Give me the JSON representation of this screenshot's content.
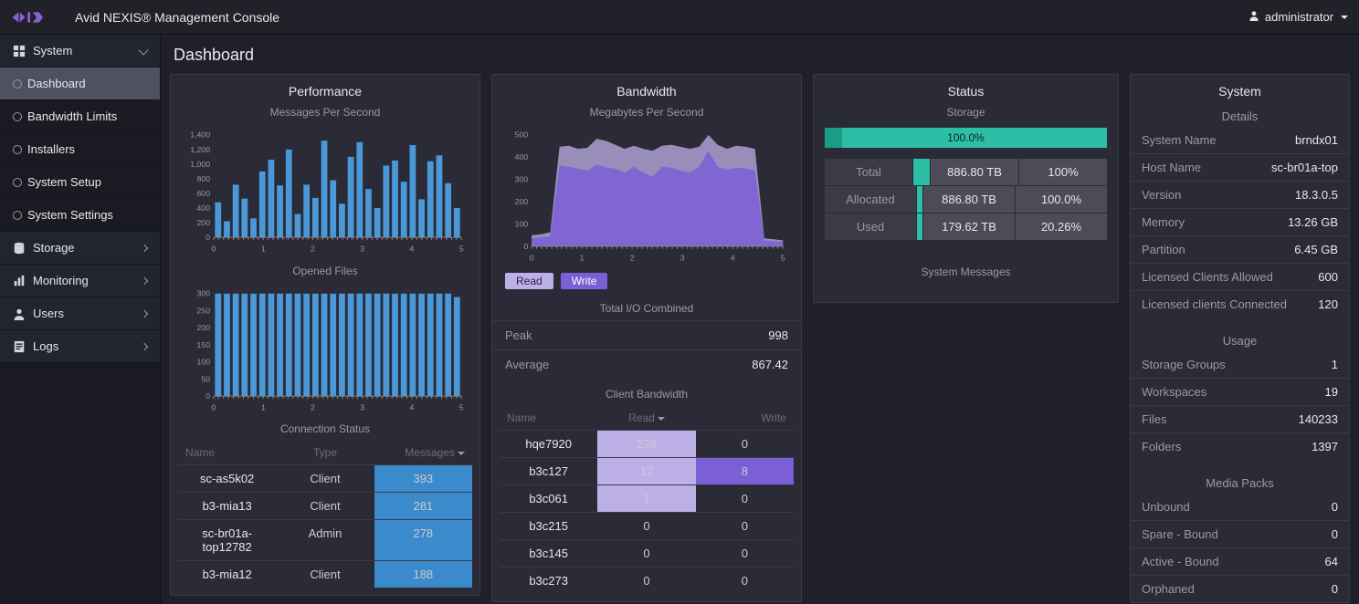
{
  "app_title": "Avid NEXIS® Management Console",
  "user": "administrator",
  "sidebar": {
    "system": {
      "label": "System",
      "expanded": true,
      "items": [
        {
          "label": "Dashboard",
          "active": true
        },
        {
          "label": "Bandwidth Limits"
        },
        {
          "label": "Installers"
        },
        {
          "label": "System Setup"
        },
        {
          "label": "System Settings"
        }
      ]
    },
    "sections": [
      {
        "label": "Storage"
      },
      {
        "label": "Monitoring"
      },
      {
        "label": "Users"
      },
      {
        "label": "Logs"
      }
    ]
  },
  "page_title": "Dashboard",
  "performance": {
    "title": "Performance",
    "messages": {
      "label": "Messages Per Second",
      "ymax": 1400,
      "xticks": [
        "0",
        "1",
        "2",
        "3",
        "4",
        "5"
      ],
      "yticks": [
        "0",
        "200",
        "400",
        "600",
        "800",
        "1,000",
        "1,200",
        "1,400"
      ]
    },
    "opened": {
      "label": "Opened Files",
      "ymax": 300,
      "xticks": [
        "0",
        "1",
        "2",
        "3",
        "4",
        "5"
      ],
      "yticks": [
        "0",
        "50",
        "100",
        "150",
        "200",
        "250",
        "300"
      ]
    },
    "conn": {
      "label": "Connection Status",
      "headers": {
        "name": "Name",
        "type": "Type",
        "messages": "Messages"
      },
      "rows": [
        {
          "name": "sc-as5k02",
          "type": "Client",
          "messages": 393
        },
        {
          "name": "b3-mia13",
          "type": "Client",
          "messages": 281
        },
        {
          "name": "sc-br01a-top12782",
          "type": "Admin",
          "messages": 278
        },
        {
          "name": "b3-mia12",
          "type": "Client",
          "messages": 188
        }
      ]
    }
  },
  "bandwidth": {
    "title": "Bandwidth",
    "mbps": {
      "label": "Megabytes Per Second",
      "xticks": [
        "0",
        "1",
        "2",
        "3",
        "4",
        "5"
      ],
      "yticks": [
        "0",
        "100",
        "200",
        "300",
        "400",
        "500"
      ]
    },
    "legend": {
      "read": "Read",
      "write": "Write"
    },
    "totalio": {
      "label": "Total I/O Combined",
      "peak_label": "Peak",
      "peak": 998,
      "avg_label": "Average",
      "avg": 867.42
    },
    "client": {
      "label": "Client Bandwidth",
      "headers": {
        "name": "Name",
        "read": "Read",
        "write": "Write"
      },
      "rows": [
        {
          "name": "hqe7920",
          "read": 278,
          "write": 0,
          "hl_read": true
        },
        {
          "name": "b3c127",
          "read": 17,
          "write": 8,
          "hl_read": true,
          "hl_write": true
        },
        {
          "name": "b3c061",
          "read": 1,
          "write": 0,
          "hl_read": true
        },
        {
          "name": "b3c215",
          "read": 0,
          "write": 0
        },
        {
          "name": "b3c145",
          "read": 0,
          "write": 0
        },
        {
          "name": "b3c273",
          "read": 0,
          "write": 0
        }
      ]
    }
  },
  "status": {
    "title": "Status",
    "storage_label": "Storage",
    "progress": {
      "pct": "100.0%",
      "inner": 6
    },
    "rows": [
      {
        "label": "Total",
        "bar": 100,
        "value": "886.80 TB",
        "pct": "100%"
      },
      {
        "label": "Allocated",
        "bar": 7,
        "value": "886.80 TB",
        "pct": "100.0%"
      },
      {
        "label": "Used",
        "bar": 7,
        "value": "179.62 TB",
        "pct": "20.26%"
      }
    ],
    "messages_label": "System Messages"
  },
  "system": {
    "title": "System",
    "details_label": "Details",
    "details": [
      {
        "k": "System Name",
        "v": "brndx01"
      },
      {
        "k": "Host Name",
        "v": "sc-br01a-top"
      },
      {
        "k": "Version",
        "v": "18.3.0.5"
      },
      {
        "k": "Memory",
        "v": "13.26 GB"
      },
      {
        "k": "Partition",
        "v": "6.45 GB"
      },
      {
        "k": "Licensed Clients Allowed",
        "v": "600"
      },
      {
        "k": "Licensed clients Connected",
        "v": "120"
      }
    ],
    "usage_label": "Usage",
    "usage": [
      {
        "k": "Storage Groups",
        "v": "1"
      },
      {
        "k": "Workspaces",
        "v": "19"
      },
      {
        "k": "Files",
        "v": "140233"
      },
      {
        "k": "Folders",
        "v": "1397"
      }
    ],
    "media_label": "Media Packs",
    "media": [
      {
        "k": "Unbound",
        "v": "0"
      },
      {
        "k": "Spare - Bound",
        "v": "0"
      },
      {
        "k": "Active - Bound",
        "v": "64"
      },
      {
        "k": "Orphaned",
        "v": "0"
      }
    ]
  },
  "chart_data": {
    "messages_per_second": {
      "type": "bar",
      "xlabel": "",
      "ylabel": "",
      "title": "Messages Per Second",
      "ylim": [
        0,
        1400
      ],
      "x_range": [
        0,
        5
      ],
      "values": [
        480,
        220,
        720,
        530,
        260,
        900,
        1060,
        710,
        1200,
        320,
        720,
        540,
        1320,
        780,
        460,
        1100,
        1300,
        660,
        400,
        980,
        1050,
        760,
        1260,
        520,
        1040,
        1120,
        740,
        400
      ]
    },
    "opened_files": {
      "type": "bar",
      "xlabel": "",
      "ylabel": "",
      "title": "Opened Files",
      "ylim": [
        0,
        300
      ],
      "x_range": [
        0,
        5
      ],
      "values": [
        300,
        300,
        300,
        300,
        300,
        300,
        300,
        300,
        300,
        300,
        300,
        300,
        300,
        300,
        300,
        300,
        300,
        300,
        300,
        300,
        300,
        300,
        300,
        300,
        300,
        300,
        300,
        290
      ]
    },
    "bandwidth_mbps": {
      "type": "area",
      "title": "Megabytes Per Second",
      "xlabel": "",
      "ylabel": "",
      "ylim": [
        0,
        560
      ],
      "x_range": [
        0,
        5
      ],
      "series": [
        {
          "name": "Read",
          "values": [
            55,
            60,
            70,
            500,
            505,
            490,
            495,
            540,
            530,
            510,
            490,
            505,
            490,
            480,
            505,
            510,
            500,
            490,
            500,
            560,
            510,
            490,
            505,
            500,
            490,
            40,
            35,
            30
          ]
        },
        {
          "name": "Write",
          "values": [
            40,
            45,
            50,
            405,
            400,
            390,
            380,
            410,
            395,
            390,
            370,
            400,
            370,
            350,
            400,
            395,
            380,
            370,
            400,
            480,
            400,
            385,
            395,
            390,
            380,
            30,
            25,
            22
          ]
        }
      ]
    }
  }
}
